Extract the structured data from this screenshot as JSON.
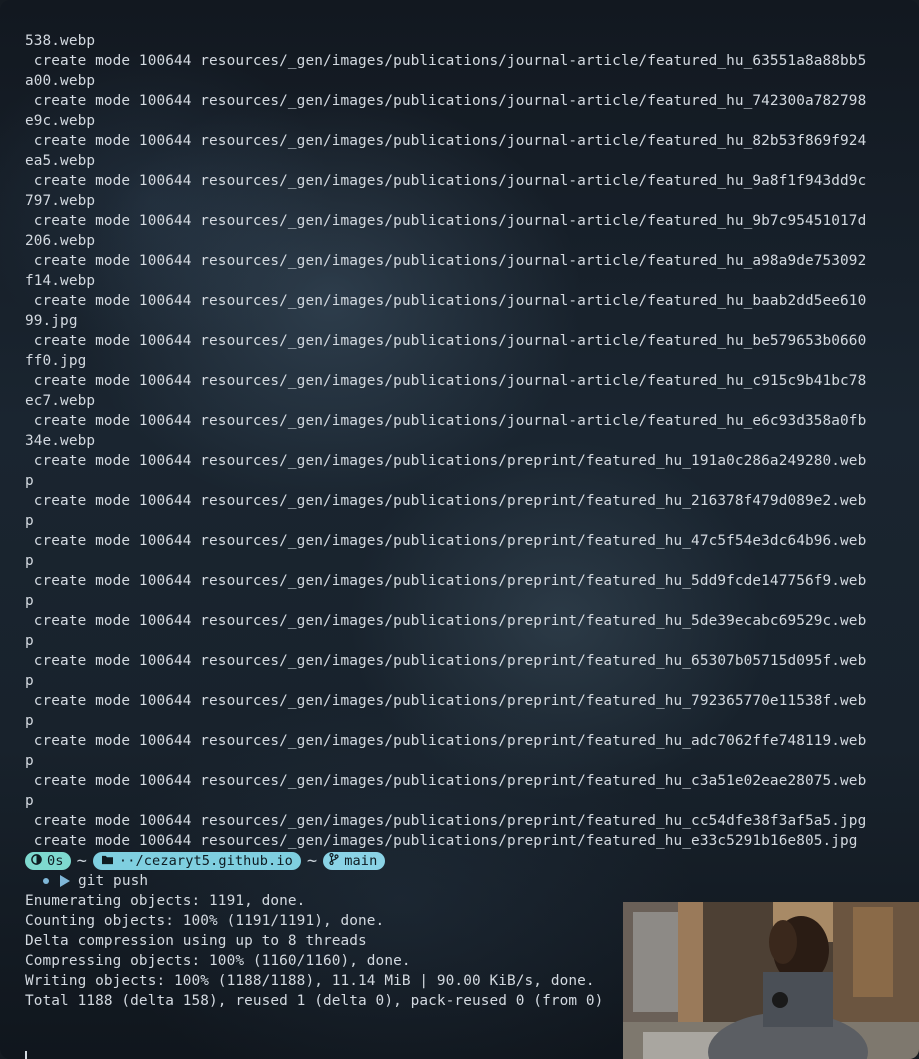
{
  "terminal": {
    "output_lines": [
      "538.webp",
      " create mode 100644 resources/_gen/images/publications/journal-article/featured_hu_63551a8a88bb5",
      "a00.webp",
      " create mode 100644 resources/_gen/images/publications/journal-article/featured_hu_742300a782798",
      "e9c.webp",
      " create mode 100644 resources/_gen/images/publications/journal-article/featured_hu_82b53f869f924",
      "ea5.webp",
      " create mode 100644 resources/_gen/images/publications/journal-article/featured_hu_9a8f1f943dd9c",
      "797.webp",
      " create mode 100644 resources/_gen/images/publications/journal-article/featured_hu_9b7c95451017d",
      "206.webp",
      " create mode 100644 resources/_gen/images/publications/journal-article/featured_hu_a98a9de753092",
      "f14.webp",
      " create mode 100644 resources/_gen/images/publications/journal-article/featured_hu_baab2dd5ee610",
      "99.jpg",
      " create mode 100644 resources/_gen/images/publications/journal-article/featured_hu_be579653b0660",
      "ff0.jpg",
      " create mode 100644 resources/_gen/images/publications/journal-article/featured_hu_c915c9b41bc78",
      "ec7.webp",
      " create mode 100644 resources/_gen/images/publications/journal-article/featured_hu_e6c93d358a0fb",
      "34e.webp",
      " create mode 100644 resources/_gen/images/publications/preprint/featured_hu_191a0c286a249280.web",
      "p",
      " create mode 100644 resources/_gen/images/publications/preprint/featured_hu_216378f479d089e2.web",
      "p",
      " create mode 100644 resources/_gen/images/publications/preprint/featured_hu_47c5f54e3dc64b96.web",
      "p",
      " create mode 100644 resources/_gen/images/publications/preprint/featured_hu_5dd9fcde147756f9.web",
      "p",
      " create mode 100644 resources/_gen/images/publications/preprint/featured_hu_5de39ecabc69529c.web",
      "p",
      " create mode 100644 resources/_gen/images/publications/preprint/featured_hu_65307b05715d095f.web",
      "p",
      " create mode 100644 resources/_gen/images/publications/preprint/featured_hu_792365770e11538f.web",
      "p",
      " create mode 100644 resources/_gen/images/publications/preprint/featured_hu_adc7062ffe748119.web",
      "p",
      " create mode 100644 resources/_gen/images/publications/preprint/featured_hu_c3a51e02eae28075.web",
      "p",
      " create mode 100644 resources/_gen/images/publications/preprint/featured_hu_cc54dfe38f3af5a5.jpg",
      " create mode 100644 resources/_gen/images/publications/preprint/featured_hu_e33c5291b16e805.jpg"
    ],
    "prompt": {
      "duration": "0s",
      "separator": "~",
      "directory": "··/cezaryt5.github.io",
      "branch": "main",
      "command": "git push"
    },
    "push_output": [
      "Enumerating objects: 1191, done.",
      "Counting objects: 100% (1191/1191), done.",
      "Delta compression using up to 8 threads",
      "Compressing objects: 100% (1160/1160), done.",
      "Writing objects: 100% (1188/1188), 11.14 MiB | 90.00 KiB/s, done.",
      "Total 1188 (delta 158), reused 1 (delta 0), pack-reused 0 (from 0)"
    ]
  },
  "icons": {
    "duration": "timer-icon",
    "directory": "folder-icon",
    "branch": "git-branch-icon",
    "status_dot": "status-dot-icon",
    "prompt_caret": "prompt-caret-icon"
  },
  "colors": {
    "text": "#d3d9e0",
    "time_segment": "#7ed9cf",
    "dir_segment": "#7fcfe0",
    "branch_segment": "#8ad3e6",
    "accent": "#7fb7d8"
  }
}
